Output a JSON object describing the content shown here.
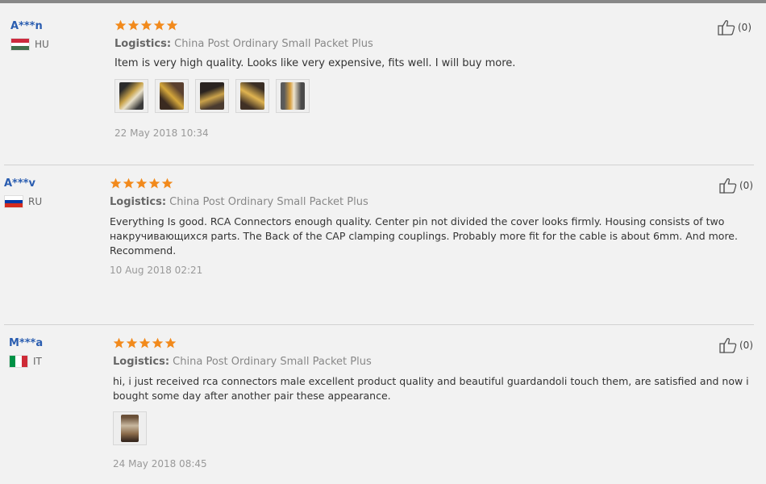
{
  "reviews": [
    {
      "user": "A***n",
      "country": "HU",
      "flag_colors": [
        "#cd2a3e",
        "#ffffff",
        "#436f4d"
      ],
      "flag_layout": "horizontal",
      "rating": 5,
      "logistics_label": "Logistics:",
      "logistics_value": "China Post Ordinary Small Packet Plus",
      "text": "Item is very high quality. Looks like very expensive, fits well. I will buy more.",
      "photos": [
        "photo-1",
        "photo-2",
        "photo-3",
        "photo-4",
        "photo-5"
      ],
      "date": "22 May 2018 10:34",
      "helpful": "(0)"
    },
    {
      "user": "A***v",
      "country": "RU",
      "flag_colors": [
        "#ffffff",
        "#0039a6",
        "#d52b1e"
      ],
      "flag_layout": "horizontal",
      "rating": 5,
      "logistics_label": "Logistics:",
      "logistics_value": "China Post Ordinary Small Packet Plus",
      "text_lines": [
        "Everything Is good. RCA Connectors enough quality. Center pin not divided the cover looks firmly. Housing consists of two",
        "накручивающихся parts. The Back of the CAP clamping couplings. Probably more fit for the cable is about 6mm. And more.",
        "Recommend."
      ],
      "date": "10 Aug 2018 02:21",
      "helpful": "(0)"
    },
    {
      "user": "M***a",
      "country": "IT",
      "flag_colors": [
        "#009246",
        "#ffffff",
        "#ce2b37"
      ],
      "flag_layout": "vertical",
      "rating": 5,
      "logistics_label": "Logistics:",
      "logistics_value": "China Post Ordinary Small Packet Plus",
      "text_lines": [
        "hi, i just received rca connectors male excellent product quality and beautiful guardandoli touch them, are satisfied and now i",
        "bought some day after another pair these appearance."
      ],
      "photos": [
        "photo-1"
      ],
      "date": "24 May 2018 08:45",
      "helpful": "(0)"
    }
  ],
  "colors": {
    "star": "#f28a1c",
    "username": "#2a5db0"
  }
}
